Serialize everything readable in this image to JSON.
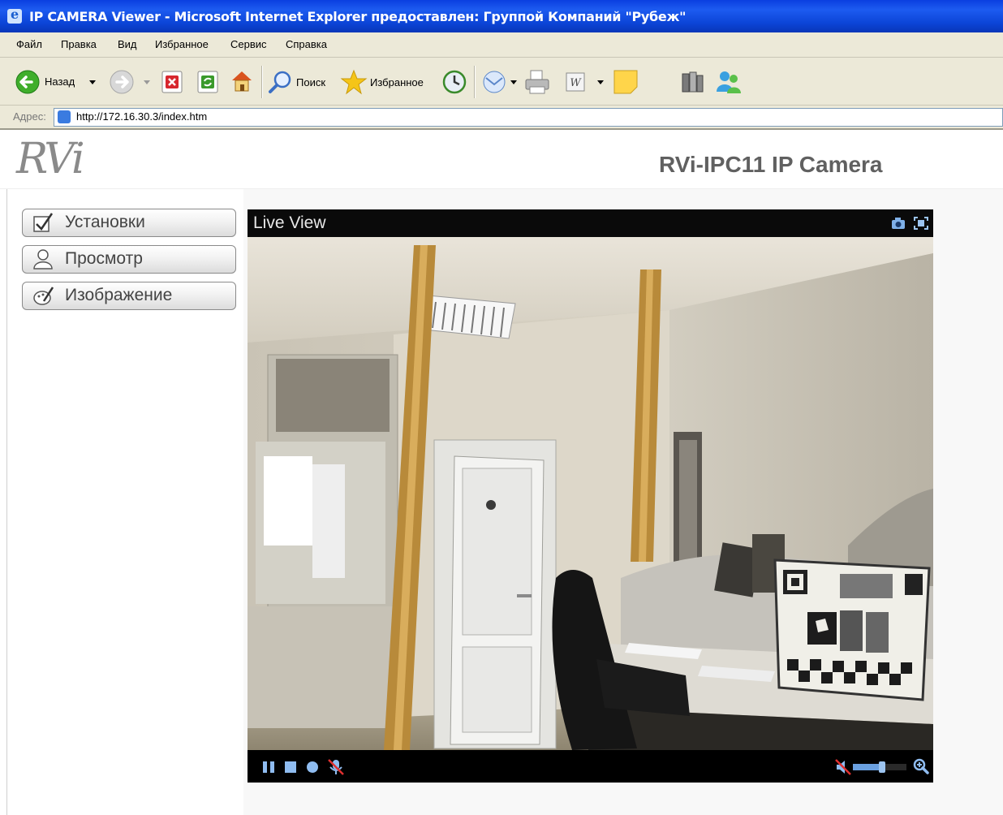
{
  "window": {
    "title": "IP CAMERA Viewer - Microsoft Internet Explorer предоставлен: Группой Компаний \"Рубеж\""
  },
  "menu": [
    "Файл",
    "Правка",
    "Вид",
    "Избранное",
    "Сервис",
    "Справка"
  ],
  "toolbar": {
    "back_label": "Назад",
    "search_label": "Поиск",
    "favorites_label": "Избранное"
  },
  "address": {
    "label": "Адрес:",
    "url": "http://172.16.30.3/index.htm"
  },
  "page": {
    "logo": "RVi",
    "title": "RVi-IPC11 IP Camera"
  },
  "sidebar": {
    "items": [
      {
        "label": "Установки",
        "icon": "checkmark-icon"
      },
      {
        "label": "Просмотр",
        "icon": "user-icon"
      },
      {
        "label": "Изображение",
        "icon": "brush-icon"
      }
    ]
  },
  "player": {
    "title": "Live View",
    "volume_level": 0.55
  }
}
